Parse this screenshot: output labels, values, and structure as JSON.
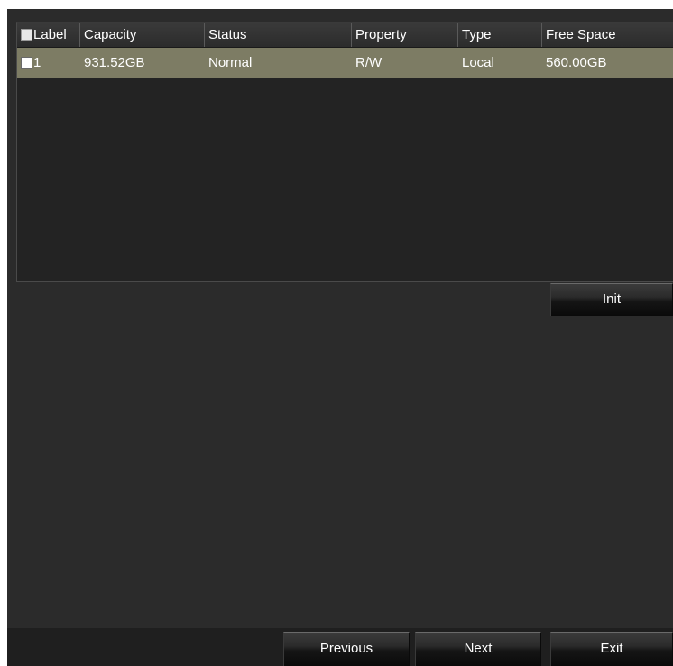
{
  "table": {
    "columns": [
      "Label",
      "Capacity",
      "Status",
      "Property",
      "Type",
      "Free Space"
    ],
    "rows": [
      {
        "label": "1",
        "capacity": "931.52GB",
        "status": "Normal",
        "property": "R/W",
        "type": "Local",
        "free_space": "560.00GB",
        "selected": true
      }
    ]
  },
  "buttons": {
    "init": "Init",
    "previous": "Previous",
    "next": "Next",
    "exit": "Exit"
  },
  "colors": {
    "background": "#2b2b2b",
    "selected_row": "#7d7c64",
    "text": "#ffffff"
  }
}
